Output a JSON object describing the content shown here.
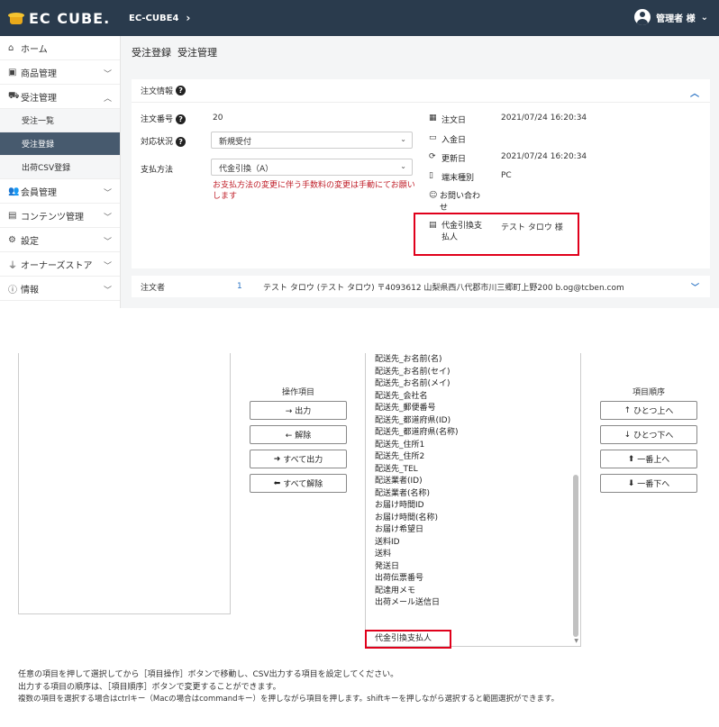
{
  "header": {
    "logo_text": "EC CUBE.",
    "breadcrumb": "EC-CUBE4",
    "user_name": "管理者 様"
  },
  "sidebar": {
    "items": [
      {
        "label": "ホーム",
        "icon": "home-icon"
      },
      {
        "label": "商品管理",
        "icon": "tag-icon"
      },
      {
        "label": "受注管理",
        "icon": "cart-icon"
      },
      {
        "label": "会員管理",
        "icon": "users-icon"
      },
      {
        "label": "コンテンツ管理",
        "icon": "file-icon"
      },
      {
        "label": "設定",
        "icon": "gear-icon"
      },
      {
        "label": "オーナーズストア",
        "icon": "plug-icon"
      },
      {
        "label": "情報",
        "icon": "info-icon"
      }
    ],
    "subitems": [
      {
        "label": "受注一覧"
      },
      {
        "label": "受注登録"
      },
      {
        "label": "出荷CSV登録"
      }
    ]
  },
  "page": {
    "title": "受注登録",
    "subtitle": "受注管理"
  },
  "order": {
    "section_title": "注文情報",
    "order_no_label": "注文番号",
    "order_no": "20",
    "status_label": "対応状況",
    "status_value": "新規受付",
    "payment_label": "支払方法",
    "payment_value": "代金引換（A）",
    "payment_warning_1": "お支払方法の変更に伴う手数料の変更は手動にてお願い",
    "payment_warning_2": "します",
    "order_date_label": "注文日",
    "order_date": "2021/07/24 16:20:34",
    "payment_date_label": "入金日",
    "updated_label": "更新日",
    "updated_date": "2021/07/24 16:20:34",
    "device_label": "端末種別",
    "device_value": "PC",
    "inquiry_label_1": "お問い合わ",
    "inquiry_label_2": "せ",
    "cod_label_1": "代金引換支",
    "cod_label_2": "払人",
    "cod_value": "テスト タロウ 様"
  },
  "orderer": {
    "label": "注文者",
    "id": "1",
    "info": "テスト タロウ (テスト タロウ) 〒4093612 山梨県西八代郡市川三郷町上野200 b.og@tcben.com"
  },
  "csv": {
    "operation_title": "操作項目",
    "order_title": "項目順序",
    "btn_output": "→ 出力",
    "btn_remove": "← 解除",
    "btn_output_all": "すべて出力",
    "btn_remove_all": "すべて解除",
    "btn_up": "ひとつ上へ",
    "btn_down": "ひとつ下へ",
    "btn_top": "一番上へ",
    "btn_bottom": "一番下へ",
    "items": [
      "配送先_お名前(名)",
      "配送先_お名前(セイ)",
      "配送先_お名前(メイ)",
      "配送先_会社名",
      "配送先_郵便番号",
      "配送先_都道府県(ID)",
      "配送先_都道府県(名称)",
      "配送先_住所1",
      "配送先_住所2",
      "配送先_TEL",
      "配送業者(ID)",
      "配送業者(名称)",
      "お届け時間ID",
      "お届け時間(名称)",
      "お届け希望日",
      "送料ID",
      "送料",
      "発送日",
      "出荷伝票番号",
      "配達用メモ",
      "出荷メール送信日",
      "代金引換支払人"
    ],
    "help_1": "任意の項目を押して選択してから［項目操作］ボタンで移動し、CSV出力する項目を設定してください。",
    "help_2": "出力する項目の順序は、［項目順序］ボタンで変更することができます。",
    "help_3": "複数の項目を選択する場合はctrlキー（Macの場合はcommandキー）を押しながら項目を押します。shiftキーを押しながら選択すると範囲選択ができます。"
  },
  "colors": {
    "header_bg": "#2a3b4d",
    "active_nav": "#475a6e",
    "highlight": "#e0001b",
    "warning_text": "#c0202a"
  }
}
